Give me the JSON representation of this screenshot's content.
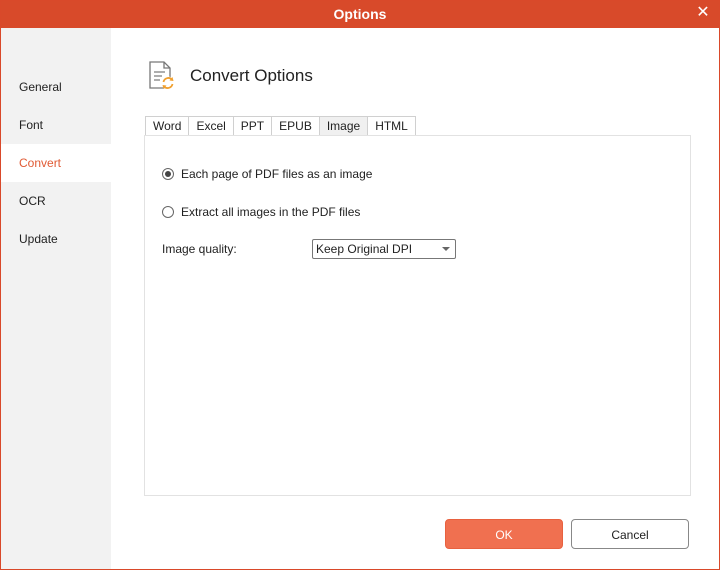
{
  "window": {
    "title": "Options",
    "close_symbol": "✕"
  },
  "sidebar": {
    "items": [
      {
        "label": "General",
        "active": false
      },
      {
        "label": "Font",
        "active": false
      },
      {
        "label": "Convert",
        "active": true
      },
      {
        "label": "OCR",
        "active": false
      },
      {
        "label": "Update",
        "active": false
      }
    ]
  },
  "header": {
    "icon": "convert-document-icon",
    "title": "Convert Options"
  },
  "tabs": [
    {
      "label": "Word",
      "active": false
    },
    {
      "label": "Excel",
      "active": false
    },
    {
      "label": "PPT",
      "active": false
    },
    {
      "label": "EPUB",
      "active": false
    },
    {
      "label": "Image",
      "active": true
    },
    {
      "label": "HTML",
      "active": false
    }
  ],
  "image_options": {
    "radio_each_page": {
      "label": "Each page of PDF files as an image",
      "checked": true
    },
    "radio_extract": {
      "label": "Extract all images in the PDF files",
      "checked": false
    },
    "quality_label": "Image quality:",
    "quality_value": "Keep Original DPI"
  },
  "buttons": {
    "ok": "OK",
    "cancel": "Cancel"
  },
  "colors": {
    "accent": "#d84a2a",
    "ok_button": "#f07050",
    "active_text": "#e05a34"
  }
}
